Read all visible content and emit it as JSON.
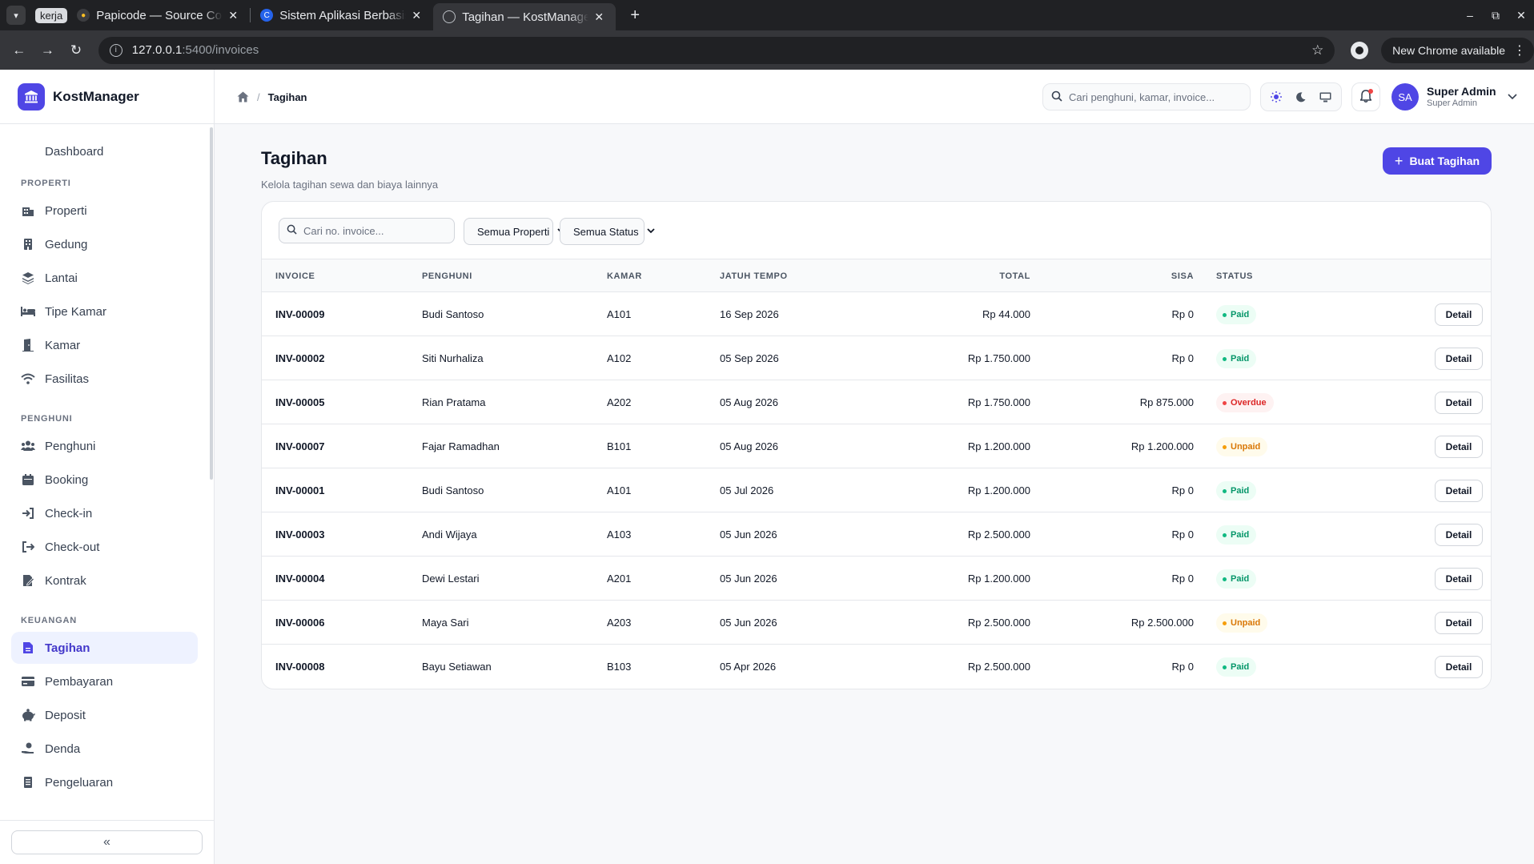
{
  "browser": {
    "tab_group": "kerja",
    "tabs": [
      {
        "title": "Papicode — Source Code",
        "active": false
      },
      {
        "title": "Sistem Aplikasi Berbasis",
        "active": false
      },
      {
        "title": "Tagihan — KostManager",
        "active": true
      }
    ],
    "url_host": "127.0.0.1",
    "url_path": ":5400/invoices",
    "update_label": "New Chrome available"
  },
  "brand": {
    "name": "KostManager",
    "color": "#4f46e5"
  },
  "sidebar": {
    "items": [
      {
        "label": "Dashboard",
        "icon": "dashboard-icon"
      },
      {
        "section": "PROPERTI"
      },
      {
        "label": "Properti",
        "icon": "building-icon"
      },
      {
        "label": "Gedung",
        "icon": "office-icon"
      },
      {
        "label": "Lantai",
        "icon": "layers-icon"
      },
      {
        "label": "Tipe Kamar",
        "icon": "bed-icon"
      },
      {
        "label": "Kamar",
        "icon": "door-icon"
      },
      {
        "label": "Fasilitas",
        "icon": "wifi-icon"
      },
      {
        "section": "PENGHUNI"
      },
      {
        "label": "Penghuni",
        "icon": "users-icon"
      },
      {
        "label": "Booking",
        "icon": "calendar-icon"
      },
      {
        "label": "Check-in",
        "icon": "login-icon"
      },
      {
        "label": "Check-out",
        "icon": "logout-icon"
      },
      {
        "label": "Kontrak",
        "icon": "contract-icon"
      },
      {
        "section": "KEUANGAN"
      },
      {
        "label": "Tagihan",
        "icon": "invoice-icon",
        "active": true
      },
      {
        "label": "Pembayaran",
        "icon": "card-icon"
      },
      {
        "label": "Deposit",
        "icon": "piggy-bank-icon"
      },
      {
        "label": "Denda",
        "icon": "hand-coin-icon"
      },
      {
        "label": "Pengeluaran",
        "icon": "receipt-icon"
      }
    ],
    "collapse_label": "«"
  },
  "topbar": {
    "breadcrumb": "Tagihan",
    "search_placeholder": "Cari penghuni, kamar, invoice...",
    "user_name": "Super Admin",
    "user_role": "Super Admin",
    "user_initials": "SA"
  },
  "page": {
    "title": "Tagihan",
    "subtitle": "Kelola tagihan sewa dan biaya lainnya",
    "create_button": "Buat Tagihan"
  },
  "filters": {
    "search_placeholder": "Cari no. invoice...",
    "property_select": "Semua Properti",
    "status_select": "Semua Status"
  },
  "table": {
    "columns": [
      "INVOICE",
      "PENGHUNI",
      "KAMAR",
      "JATUH TEMPO",
      "TOTAL",
      "SISA",
      "STATUS"
    ],
    "detail_label": "Detail",
    "rows": [
      {
        "invoice": "INV-00009",
        "tenant": "Budi Santoso",
        "room": "A101",
        "due": "16 Sep 2026",
        "total": "Rp 44.000",
        "balance": "Rp 0",
        "status": "Paid"
      },
      {
        "invoice": "INV-00002",
        "tenant": "Siti Nurhaliza",
        "room": "A102",
        "due": "05 Sep 2026",
        "total": "Rp 1.750.000",
        "balance": "Rp 0",
        "status": "Paid"
      },
      {
        "invoice": "INV-00005",
        "tenant": "Rian Pratama",
        "room": "A202",
        "due": "05 Aug 2026",
        "total": "Rp 1.750.000",
        "balance": "Rp 875.000",
        "status": "Overdue"
      },
      {
        "invoice": "INV-00007",
        "tenant": "Fajar Ramadhan",
        "room": "B101",
        "due": "05 Aug 2026",
        "total": "Rp 1.200.000",
        "balance": "Rp 1.200.000",
        "status": "Unpaid"
      },
      {
        "invoice": "INV-00001",
        "tenant": "Budi Santoso",
        "room": "A101",
        "due": "05 Jul 2026",
        "total": "Rp 1.200.000",
        "balance": "Rp 0",
        "status": "Paid"
      },
      {
        "invoice": "INV-00003",
        "tenant": "Andi Wijaya",
        "room": "A103",
        "due": "05 Jun 2026",
        "total": "Rp 2.500.000",
        "balance": "Rp 0",
        "status": "Paid"
      },
      {
        "invoice": "INV-00004",
        "tenant": "Dewi Lestari",
        "room": "A201",
        "due": "05 Jun 2026",
        "total": "Rp 1.200.000",
        "balance": "Rp 0",
        "status": "Paid"
      },
      {
        "invoice": "INV-00006",
        "tenant": "Maya Sari",
        "room": "A203",
        "due": "05 Jun 2026",
        "total": "Rp 2.500.000",
        "balance": "Rp 2.500.000",
        "status": "Unpaid"
      },
      {
        "invoice": "INV-00008",
        "tenant": "Bayu Setiawan",
        "room": "B103",
        "due": "05 Apr 2026",
        "total": "Rp 2.500.000",
        "balance": "Rp 0",
        "status": "Paid"
      }
    ]
  }
}
